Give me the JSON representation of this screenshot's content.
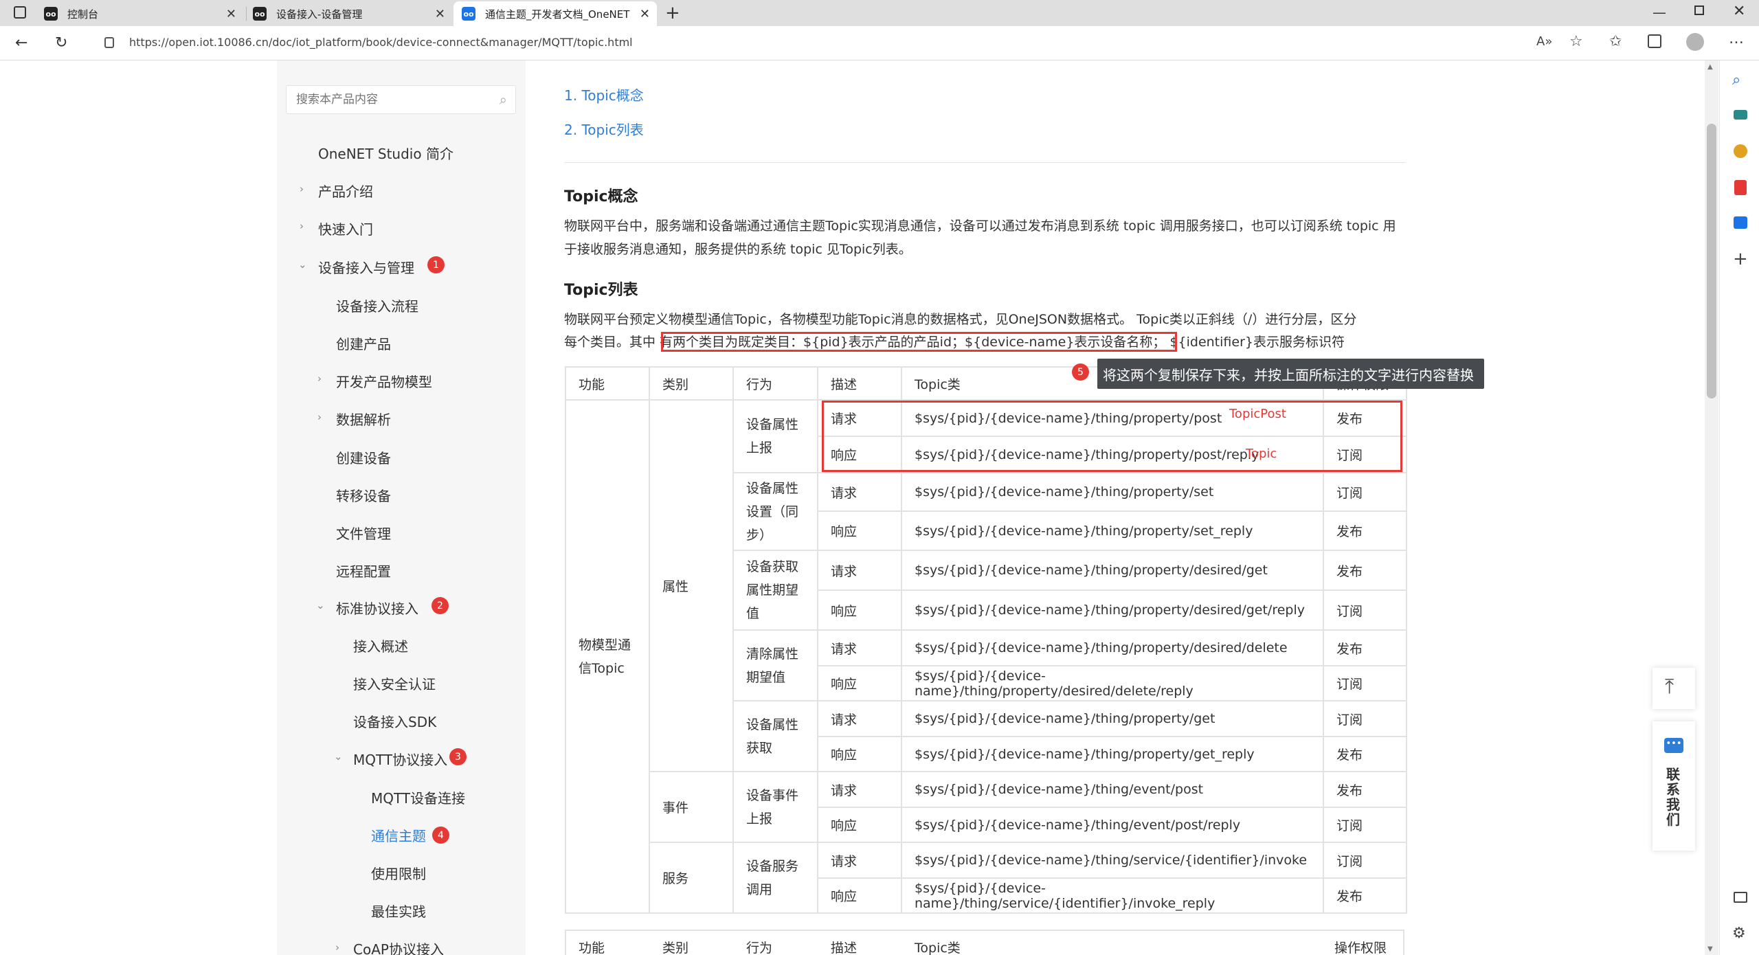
{
  "browser": {
    "tabs": [
      {
        "label": "控制台",
        "active": false
      },
      {
        "label": "设备接入-设备管理",
        "active": false
      },
      {
        "label": "通信主题_开发者文档_OneNET",
        "active": true
      }
    ],
    "favicon_text": "oo",
    "url": "https://open.iot.10086.cn/doc/iot_platform/book/device-connect&manager/MQTT/topic.html"
  },
  "sidebar": {
    "search_placeholder": "搜索本产品内容",
    "items": [
      {
        "label": "OneNET Studio 简介"
      },
      {
        "label": "产品介绍"
      },
      {
        "label": "快速入门"
      },
      {
        "label": "设备接入与管理",
        "badge": "1"
      },
      {
        "label": "设备接入流程"
      },
      {
        "label": "创建产品"
      },
      {
        "label": "开发产品物模型"
      },
      {
        "label": "数据解析"
      },
      {
        "label": "创建设备"
      },
      {
        "label": "转移设备"
      },
      {
        "label": "文件管理"
      },
      {
        "label": "远程配置"
      },
      {
        "label": "标准协议接入",
        "badge": "2"
      },
      {
        "label": "接入概述"
      },
      {
        "label": "接入安全认证"
      },
      {
        "label": "设备接入SDK"
      },
      {
        "label": "MQTT协议接入",
        "badge": "3"
      },
      {
        "label": "MQTT设备连接"
      },
      {
        "label": "通信主题",
        "badge": "4"
      },
      {
        "label": "使用限制"
      },
      {
        "label": "最佳实践"
      },
      {
        "label": "CoAP协议接入"
      }
    ]
  },
  "content": {
    "toc": [
      "1. Topic概念",
      "2. Topic列表"
    ],
    "section1_title": "Topic概念",
    "section1_text": "物联网平台中，服务端和设备端通过通信主题Topic实现消息通信，设备可以通过发布消息到系统 topic 调用服务接口，也可以订阅系统 topic 用于接收服务消息通知，服务提供的系统 topic 见Topic列表。",
    "section2_title": "Topic列表",
    "section2_line1": "物联网平台预定义物模型通信Topic，各物模型功能Topic消息的数据格式，见OneJSON数据格式。 Topic类以正斜线（/）进行分层，区分",
    "section2_line2_pre": "每个类目。其中",
    "section2_line2_hl": "有两个类目为既定类目：${pid}表示产品的产品id；${device-name}表示设备名称；",
    "section2_line2_post": "${identifier}表示服务标识符",
    "annotation_badge": "5",
    "tooltip": "将这两个复制保存下来，并按上面所标注的文字进行内容替换",
    "label_topicpost": "TopicPost",
    "label_topic": "Topic"
  },
  "table": {
    "headers": [
      "功能",
      "类别",
      "行为",
      "描述",
      "Topic类",
      "操作权限"
    ],
    "func": "物模型通信Topic",
    "categories": [
      "属性",
      "事件",
      "服务"
    ],
    "behaviors": [
      "设备属性上报",
      "设备属性设置（同步）",
      "设备获取属性期望值",
      "清除属性期望值",
      "设备属性获取",
      "设备事件上报",
      "设备服务调用"
    ],
    "rows": [
      {
        "desc": "请求",
        "topic": "$sys/{pid}/{device-name}/thing/property/post",
        "perm": "发布"
      },
      {
        "desc": "响应",
        "topic": "$sys/{pid}/{device-name}/thing/property/post/reply",
        "perm": "订阅"
      },
      {
        "desc": "请求",
        "topic": "$sys/{pid}/{device-name}/thing/property/set",
        "perm": "订阅"
      },
      {
        "desc": "响应",
        "topic": "$sys/{pid}/{device-name}/thing/property/set_reply",
        "perm": "发布"
      },
      {
        "desc": "请求",
        "topic": "$sys/{pid}/{device-name}/thing/property/desired/get",
        "perm": "发布"
      },
      {
        "desc": "响应",
        "topic": "$sys/{pid}/{device-name}/thing/property/desired/get/reply",
        "perm": "订阅"
      },
      {
        "desc": "请求",
        "topic": "$sys/{pid}/{device-name}/thing/property/desired/delete",
        "perm": "发布"
      },
      {
        "desc": "响应",
        "topic": "$sys/{pid}/{device-name}/thing/property/desired/delete/reply",
        "perm": "订阅"
      },
      {
        "desc": "请求",
        "topic": "$sys/{pid}/{device-name}/thing/property/get",
        "perm": "订阅"
      },
      {
        "desc": "响应",
        "topic": "$sys/{pid}/{device-name}/thing/property/get_reply",
        "perm": "发布"
      },
      {
        "desc": "请求",
        "topic": "$sys/{pid}/{device-name}/thing/event/post",
        "perm": "发布"
      },
      {
        "desc": "响应",
        "topic": "$sys/{pid}/{device-name}/thing/event/post/reply",
        "perm": "订阅"
      },
      {
        "desc": "请求",
        "topic": "$sys/{pid}/{device-name}/thing/service/{identifier}/invoke",
        "perm": "订阅"
      },
      {
        "desc": "响应",
        "topic": "$sys/{pid}/{device-name}/thing/service/{identifier}/invoke_reply",
        "perm": "发布"
      }
    ]
  },
  "float": {
    "contact": "联系我们"
  },
  "colors": {
    "accent": "#2e7ed8",
    "annotation": "#e53935",
    "tooltip_bg": "#474b50"
  }
}
